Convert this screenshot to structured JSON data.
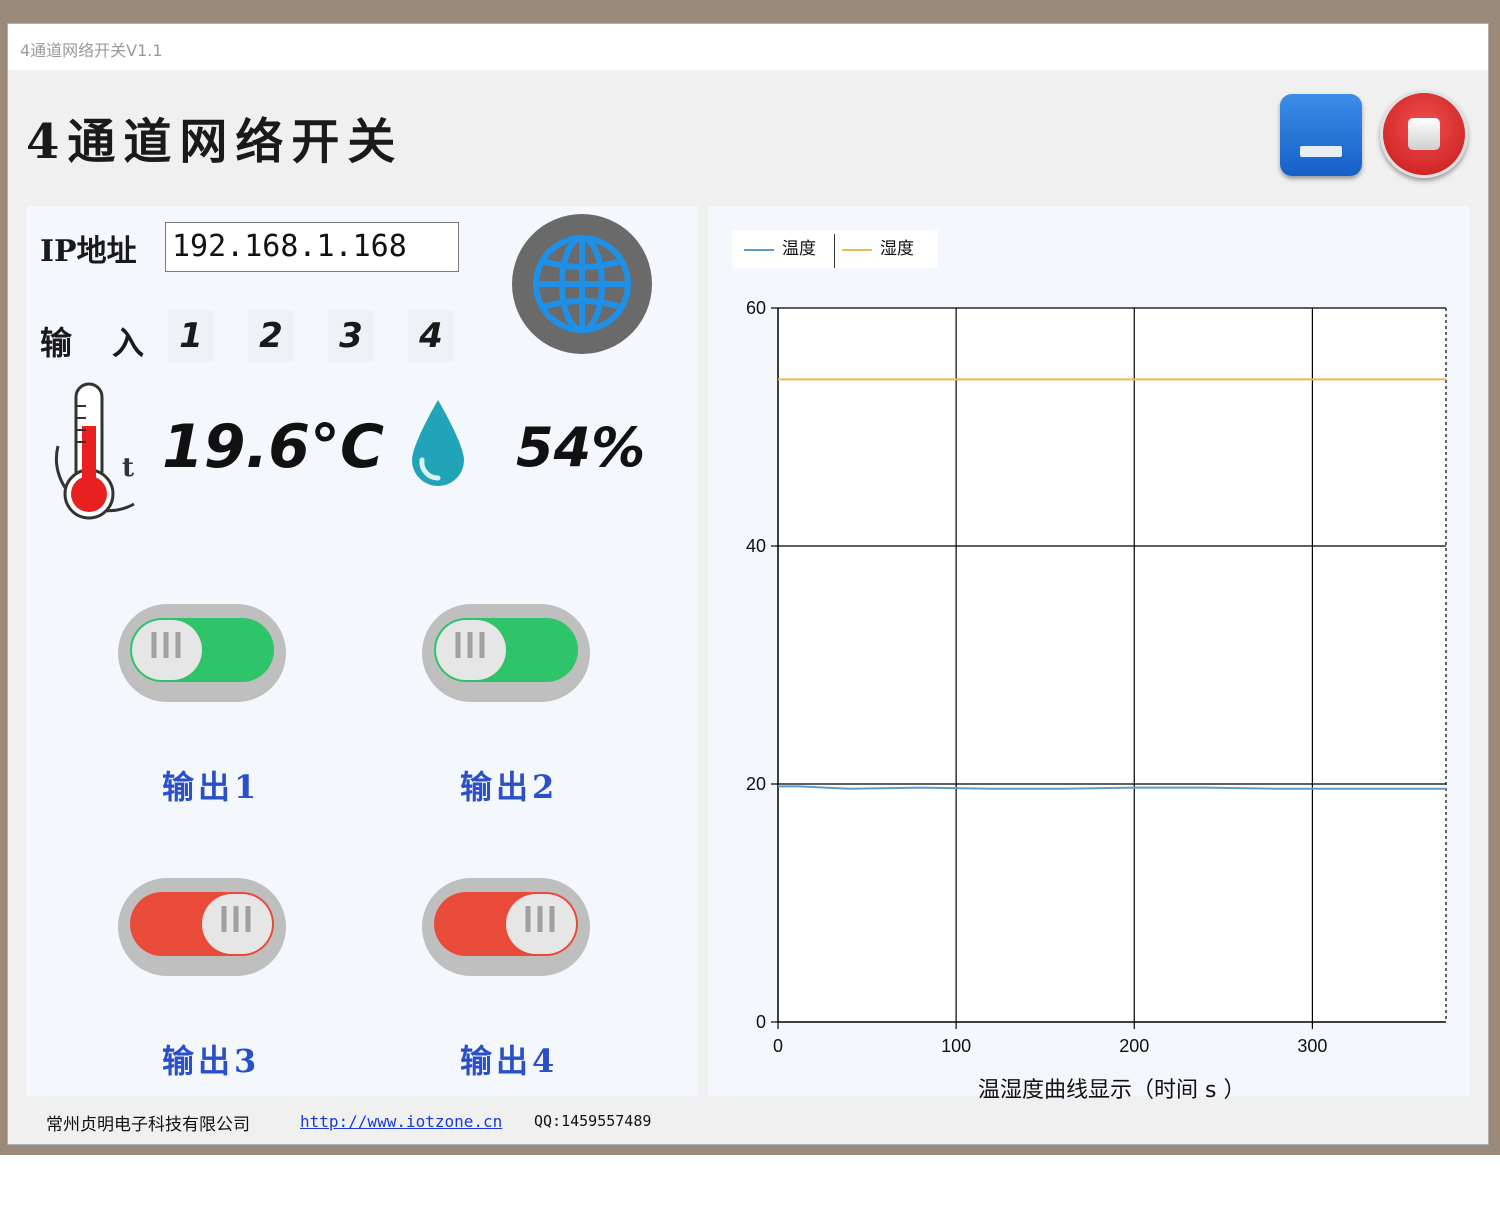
{
  "window": {
    "title": "4通道网络开关V1.1"
  },
  "app": {
    "title": "4通道网络开关"
  },
  "network": {
    "ip_label": "IP地址",
    "ip_value": "192.168.1.168"
  },
  "inputs": {
    "label": "输入",
    "numbers": [
      "1",
      "2",
      "3",
      "4"
    ]
  },
  "sensors": {
    "temperature": "19.6°C",
    "humidity": "54%"
  },
  "outputs": [
    {
      "label": "输出1",
      "state": "on",
      "color": "#2ec46a"
    },
    {
      "label": "输出2",
      "state": "on",
      "color": "#2ec46a"
    },
    {
      "label": "输出3",
      "state": "off",
      "color": "#e84b3a"
    },
    {
      "label": "输出4",
      "state": "off",
      "color": "#e84b3a"
    }
  ],
  "footer": {
    "company": "常州贞明电子科技有限公司",
    "link": "http://www.iotzone.cn",
    "qq": "QQ:1459557489"
  },
  "chart_data": {
    "type": "line",
    "xlabel": "温湿度曲线显示（时间 s ）",
    "xlim": [
      0,
      375
    ],
    "ylim": [
      0,
      60
    ],
    "xticks": [
      0,
      100,
      200,
      300
    ],
    "yticks": [
      0,
      20,
      40,
      60
    ],
    "grid": true,
    "legend": "top-left",
    "series": [
      {
        "name": "温度",
        "color": "#5b9bd5",
        "x": [
          0,
          12,
          40,
          80,
          120,
          160,
          200,
          240,
          280,
          320,
          360,
          375
        ],
        "y": [
          19.8,
          19.8,
          19.6,
          19.7,
          19.6,
          19.6,
          19.7,
          19.7,
          19.6,
          19.6,
          19.6,
          19.6
        ]
      },
      {
        "name": "湿度",
        "color": "#f0b850",
        "x": [
          0,
          100,
          200,
          300,
          375
        ],
        "y": [
          54,
          54,
          54,
          54,
          54
        ]
      }
    ]
  }
}
